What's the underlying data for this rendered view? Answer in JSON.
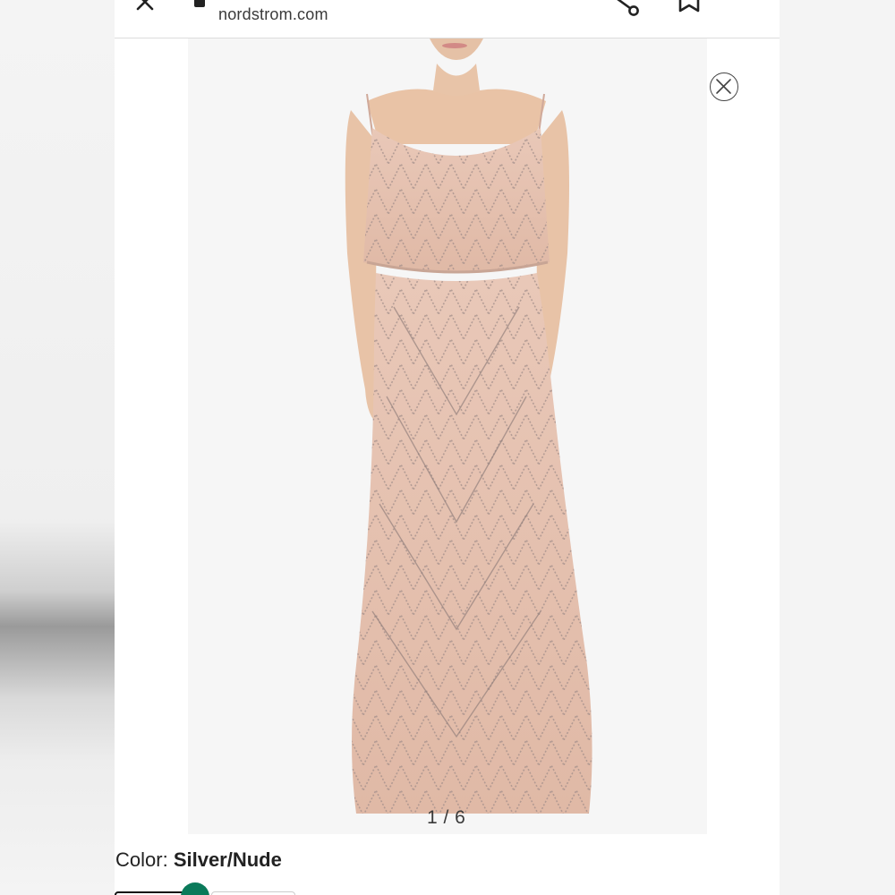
{
  "browser": {
    "url": "nordstrom.com",
    "icons": [
      "close-icon",
      "lock-icon",
      "share-icon",
      "bookmark-icon",
      "more-vert-icon"
    ]
  },
  "gallery": {
    "pager": "1 / 6",
    "close_icon": "close-circle-icon"
  },
  "product": {
    "color_label": "Color:",
    "color_value": "Silver/Nude"
  },
  "colors": {
    "dress": "#e6c2b0",
    "beading": "#9e8b88",
    "skin": "#e9c3a6",
    "swatch_selected": "#0a7a5a",
    "image_bg": "#f6f6f6"
  }
}
